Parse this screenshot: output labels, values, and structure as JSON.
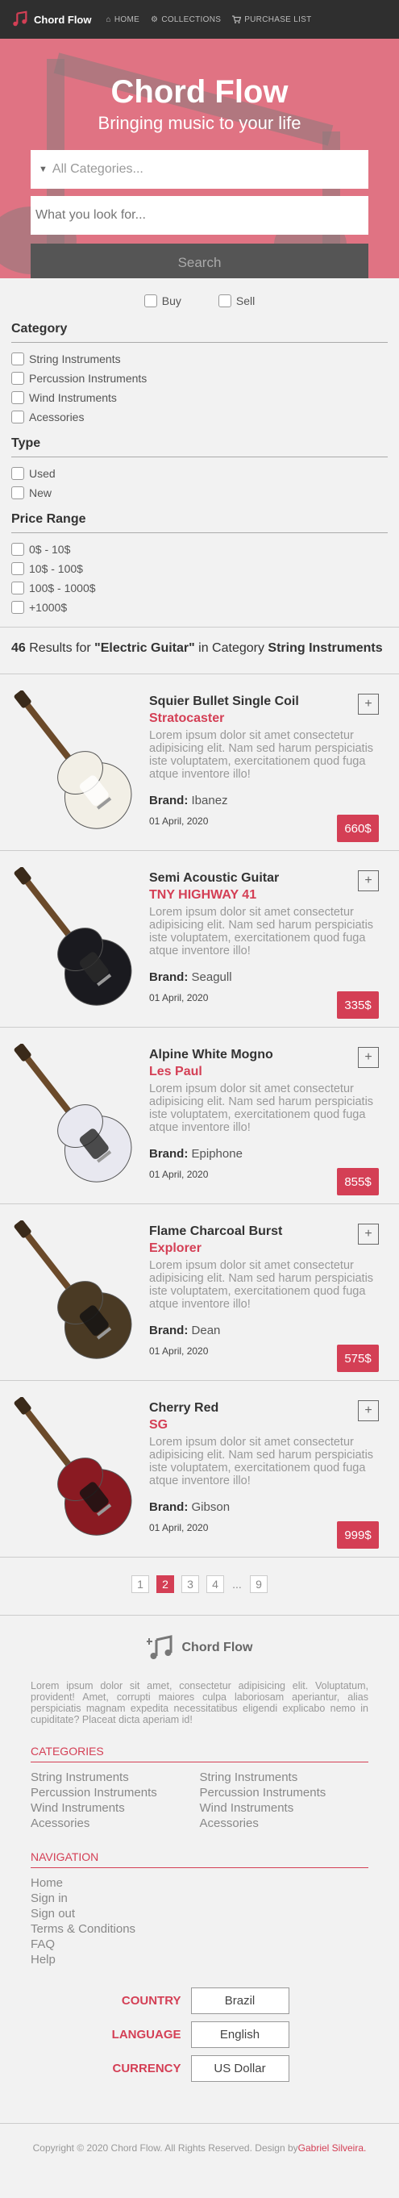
{
  "topbar": {
    "logo_text": "Chord Flow",
    "nav": [
      {
        "icon": "home-icon",
        "label": "HOME"
      },
      {
        "icon": "gear-icon",
        "label": "COLLECTIONS"
      },
      {
        "icon": "cart-icon",
        "label": "PURCHASE LIST"
      }
    ]
  },
  "hero": {
    "title": "Chord Flow",
    "subtitle": "Bringing music to your life",
    "category_placeholder": "All Categories...",
    "search_placeholder": "What you look for...",
    "search_button": "Search",
    "background_color": "#e07383"
  },
  "filters": {
    "buy_label": "Buy",
    "sell_label": "Sell",
    "category": {
      "title": "Category",
      "items": [
        "String Instruments",
        "Percussion Instruments",
        "Wind Instruments",
        "Acessories"
      ]
    },
    "type": {
      "title": "Type",
      "items": [
        "Used",
        "New"
      ]
    },
    "price": {
      "title": "Price Range",
      "items": [
        "0$ - 10$",
        "10$ - 100$",
        "100$ - 1000$",
        "+1000$"
      ]
    }
  },
  "results": {
    "count": "46",
    "results_for": " Results for ",
    "query": "\"Electric Guitar\"",
    "in_category": " in Category ",
    "category": "String Instruments"
  },
  "products": [
    {
      "name": "Squier Bullet Single Coil",
      "model": "Stratocaster",
      "desc": "Lorem ipsum dolor sit amet consectetur adipisicing elit. Nam sed harum perspiciatis iste voluptatem, exercitationem quod fuga atque inventore illo!",
      "brand_label": "Brand:",
      "brand": "Ibanez",
      "date": "01 April, 2020",
      "price": "660$",
      "add": "+",
      "body_color": "#f2efe6",
      "guard_color": "#ffffff"
    },
    {
      "name": "Semi Acoustic Guitar",
      "model": "TNY HIGHWAY 41",
      "desc": "Lorem ipsum dolor sit amet consectetur adipisicing elit. Nam sed harum perspiciatis iste voluptatem, exercitationem quod fuga atque inventore illo!",
      "brand_label": "Brand:",
      "brand": "Seagull",
      "date": "01 April, 2020",
      "price": "335$",
      "add": "+",
      "body_color": "#1a1a1f",
      "guard_color": "#2a2a2a"
    },
    {
      "name": "Alpine White Mogno",
      "model": "Les Paul",
      "desc": "Lorem ipsum dolor sit amet consectetur adipisicing elit. Nam sed harum perspiciatis iste voluptatem, exercitationem quod fuga atque inventore illo!",
      "brand_label": "Brand:",
      "brand": "Epiphone",
      "date": "01 April, 2020",
      "price": "855$",
      "add": "+",
      "body_color": "#e8e8f0",
      "guard_color": "#222"
    },
    {
      "name": "Flame Charcoal Burst",
      "model": "Explorer",
      "desc": "Lorem ipsum dolor sit amet consectetur adipisicing elit. Nam sed harum perspiciatis iste voluptatem, exercitationem quod fuga atque inventore illo!",
      "brand_label": "Brand:",
      "brand": "Dean",
      "date": "01 April, 2020",
      "price": "575$",
      "add": "+",
      "body_color": "#4a3a24",
      "guard_color": "#111"
    },
    {
      "name": "Cherry Red",
      "model": "SG",
      "desc": "Lorem ipsum dolor sit amet consectetur adipisicing elit. Nam sed harum perspiciatis iste voluptatem, exercitationem quod fuga atque inventore illo!",
      "brand_label": "Brand:",
      "brand": "Gibson",
      "date": "01 April, 2020",
      "price": "999$",
      "add": "+",
      "body_color": "#8a1a22",
      "guard_color": "#111"
    }
  ],
  "pagination": [
    "1",
    "2",
    "3",
    "4",
    "...",
    "9"
  ],
  "pagination_active": "2",
  "footer": {
    "logo_text": "Chord Flow",
    "about": "Lorem ipsum dolor sit amet, consectetur adipisicing elit. Voluptatum, provident! Amet, corrupti maiores culpa laboriosam aperiantur, alias perspiciatis magnam expedita necessitatibus eligendi explicabo nemo in cupiditate? Placeat dicta aperiam id!",
    "categories_title": "CATEGORIES",
    "categories": [
      "String Instruments",
      "String Instruments",
      "Percussion Instruments",
      "Percussion Instruments",
      "Wind Instruments",
      "Wind Instruments",
      "Acessories",
      "Acessories"
    ],
    "navigation_title": "NAVIGATION",
    "navigation": [
      "Home",
      "Sign in",
      "Sign out",
      "Terms & Conditions",
      "FAQ",
      "Help"
    ],
    "country_label": "COUNTRY",
    "country": "Brazil",
    "language_label": "LANGUAGE",
    "language": "English",
    "currency_label": "CURRENCY",
    "currency": "US Dollar",
    "copyright": "Copyright © 2020 Chord Flow. All Rights Reserved. Design by ",
    "designer": "Gabriel Silveira."
  },
  "colors": {
    "accent": "#d43f55",
    "topbar": "#2f2f2f"
  }
}
